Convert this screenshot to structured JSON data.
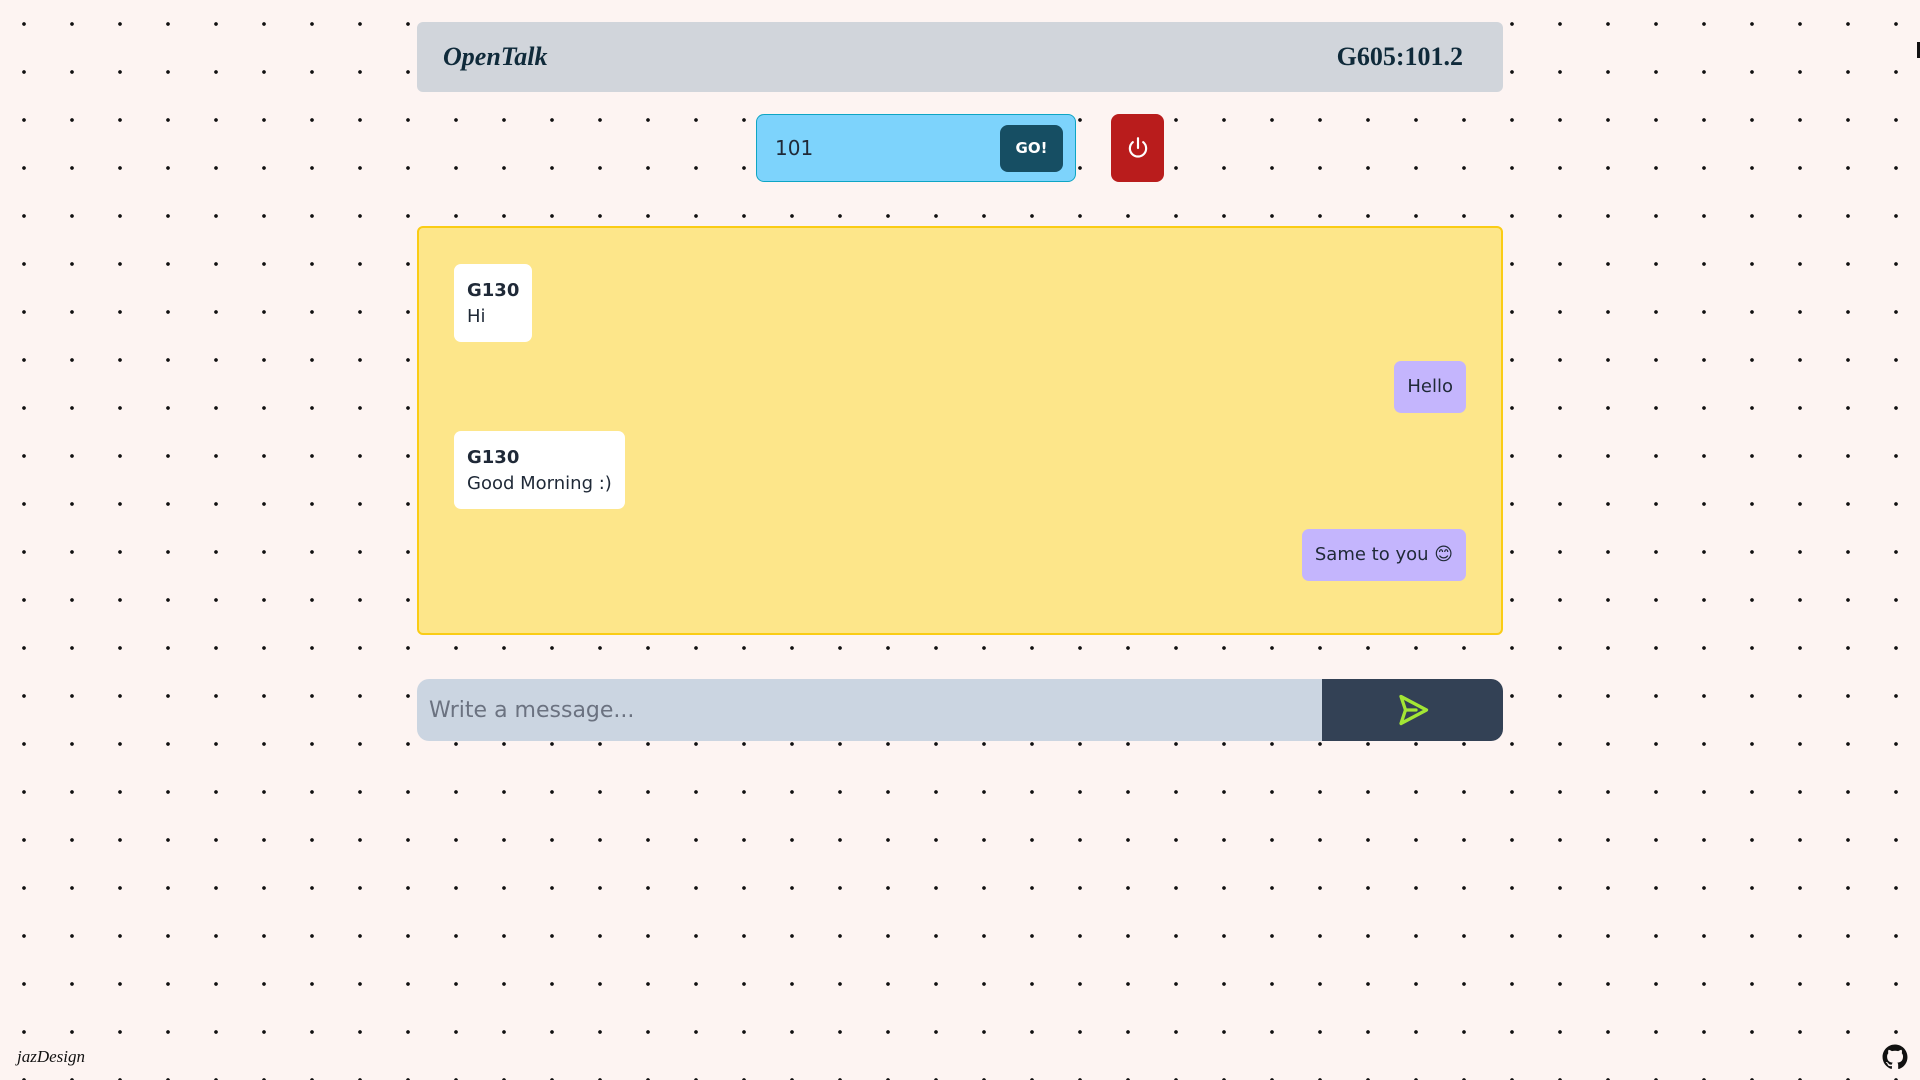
{
  "header": {
    "brand": "OpenTalk",
    "session_id": "G605:101.2"
  },
  "room": {
    "value": "101",
    "go_label": "GO!"
  },
  "power": {
    "icon": "power-icon",
    "color": "#b91c1c"
  },
  "messages": [
    {
      "direction": "incoming",
      "sender": "G130",
      "text": "Hi"
    },
    {
      "direction": "outgoing",
      "text": "Hello"
    },
    {
      "direction": "incoming",
      "sender": "G130",
      "text": "Good Morning :)"
    },
    {
      "direction": "outgoing",
      "text": "Same to you 😊"
    }
  ],
  "composer": {
    "placeholder": "Write a message...",
    "value": "",
    "send_icon": "send-icon",
    "send_icon_color": "#a3e635"
  },
  "footer": {
    "credit": "jazDesign",
    "github_icon": "github-icon"
  },
  "colors": {
    "background": "#fdf4f2",
    "header": "#d1d5db",
    "room_box": "#7dd3fc",
    "go_button": "#164e63",
    "chat_panel": "#fde68a",
    "incoming_bubble": "#ffffff",
    "outgoing_bubble": "#c4b5fd",
    "composer_input": "#cbd5e1",
    "send_button": "#334155"
  }
}
